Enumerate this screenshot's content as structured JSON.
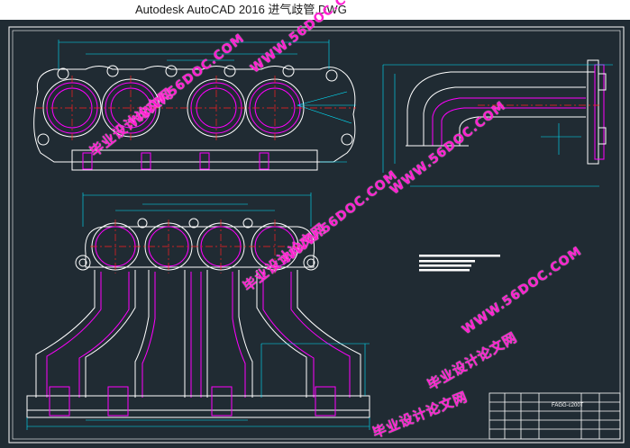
{
  "window": {
    "title": "Autodesk AutoCAD 2016    进气歧管.DWG"
  },
  "watermarks": [
    {
      "text": "毕业设计论文网"
    },
    {
      "text": "WWW.56DOC.COM"
    }
  ],
  "title_block": {
    "drawing_number": "FAGG-c200T"
  },
  "colors": {
    "background": "#202b33",
    "outline": "#ffffff",
    "inner_contour": "#ff00ff",
    "center_lines": "#ff2020",
    "dimensions": "#00e5ff",
    "watermark": "#ff1fd0"
  }
}
